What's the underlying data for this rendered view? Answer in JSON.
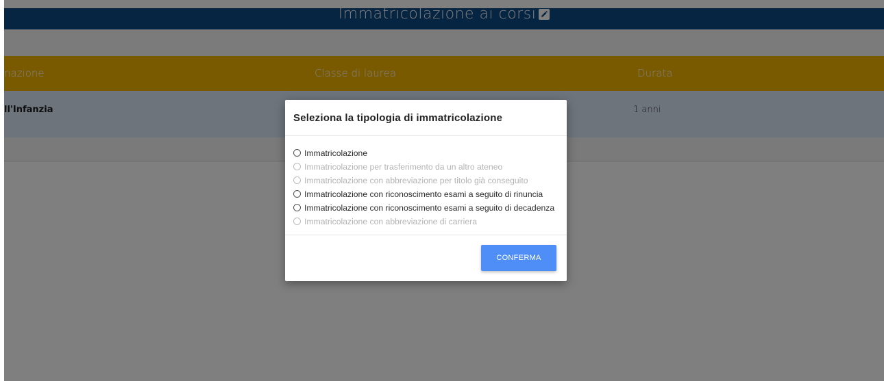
{
  "header": {
    "title": "Immatricolazione ai corsi"
  },
  "table": {
    "columns": [
      "nazione",
      "Classe di laurea",
      "Durata"
    ],
    "rows": [
      {
        "col1": "ll'Infanzia",
        "col3": "1 anni"
      }
    ]
  },
  "modal": {
    "title": "Seleziona la tipologia di immatricolazione",
    "options": [
      {
        "label": "Immatricolazione",
        "enabled": true
      },
      {
        "label": "Immatricolazione per trasferimento da un altro ateneo",
        "enabled": false
      },
      {
        "label": "Immatricolazione con abbreviazione per titolo già conseguito",
        "enabled": false
      },
      {
        "label": "Immatricolazione con riconoscimento esami a seguito di rinuncia",
        "enabled": true
      },
      {
        "label": "Immatricolazione con riconoscimento esami a seguito di decadenza",
        "enabled": true
      },
      {
        "label": "Immatricolazione con abbreviazione di carriera",
        "enabled": false
      }
    ],
    "confirm_label": "CONFERMA"
  },
  "colors": {
    "header_bg": "#0d4a86",
    "table_header_bg": "#f5b400",
    "row_bg": "#dbe9f7",
    "button_bg": "#4f8ef7"
  },
  "icons": {
    "title_icon": "edit-icon"
  }
}
